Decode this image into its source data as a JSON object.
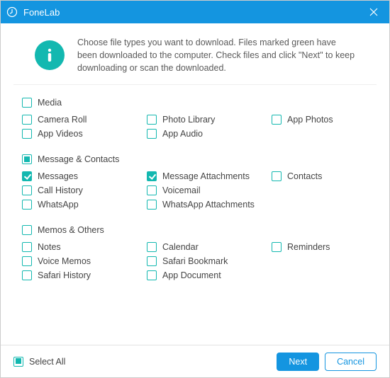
{
  "app_title": "FoneLab",
  "info_text": "Choose file types you want to download. Files marked green have been downloaded to the computer. Check files and click \"Next\" to keep downloading or scan the downloaded.",
  "sections": {
    "media": {
      "title": "Media",
      "state": "unchecked",
      "items": {
        "camera_roll": {
          "label": "Camera Roll",
          "checked": false
        },
        "photo_library": {
          "label": "Photo Library",
          "checked": false
        },
        "app_photos": {
          "label": "App Photos",
          "checked": false
        },
        "app_videos": {
          "label": "App Videos",
          "checked": false
        },
        "app_audio": {
          "label": "App Audio",
          "checked": false
        }
      }
    },
    "message_contacts": {
      "title": "Message & Contacts",
      "state": "partial",
      "items": {
        "messages": {
          "label": "Messages",
          "checked": true
        },
        "message_attachments": {
          "label": "Message Attachments",
          "checked": true
        },
        "contacts": {
          "label": "Contacts",
          "checked": false
        },
        "call_history": {
          "label": "Call History",
          "checked": false
        },
        "voicemail": {
          "label": "Voicemail",
          "checked": false
        },
        "whatsapp": {
          "label": "WhatsApp",
          "checked": false
        },
        "whatsapp_attachments": {
          "label": "WhatsApp Attachments",
          "checked": false
        }
      }
    },
    "memos_others": {
      "title": "Memos & Others",
      "state": "unchecked",
      "items": {
        "notes": {
          "label": "Notes",
          "checked": false
        },
        "calendar": {
          "label": "Calendar",
          "checked": false
        },
        "reminders": {
          "label": "Reminders",
          "checked": false
        },
        "voice_memos": {
          "label": "Voice Memos",
          "checked": false
        },
        "safari_bookmark": {
          "label": "Safari Bookmark",
          "checked": false
        },
        "safari_history": {
          "label": "Safari History",
          "checked": false
        },
        "app_document": {
          "label": "App Document",
          "checked": false
        }
      }
    }
  },
  "select_all": {
    "label": "Select All",
    "state": "partial"
  },
  "buttons": {
    "next": "Next",
    "cancel": "Cancel"
  },
  "colors": {
    "accent": "#1495e0",
    "teal": "#13b8b0"
  }
}
